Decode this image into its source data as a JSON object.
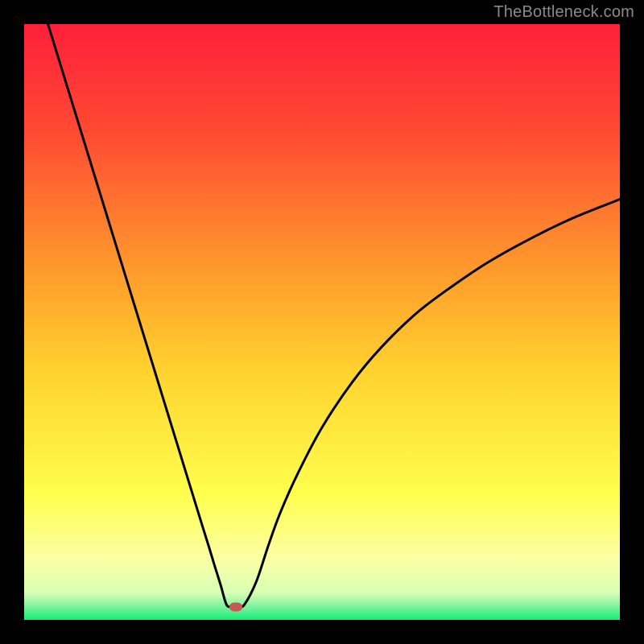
{
  "watermark": "TheBottleneck.com",
  "colors": {
    "top": "#ff1f3a",
    "mid_upper": "#ff8a2b",
    "mid": "#ffd22e",
    "pale": "#ffffb0",
    "green": "#10ef75",
    "frame": "#000000",
    "curve": "#000000",
    "marker": "#c25a52"
  },
  "chart_data": {
    "type": "line",
    "title": "",
    "xlabel": "",
    "ylabel": "",
    "xlim": [
      0,
      100
    ],
    "ylim": [
      0,
      100
    ],
    "series": [
      {
        "name": "bottleneck-curve",
        "x": [
          4,
          6,
          8,
          10,
          12,
          14,
          16,
          18,
          20,
          22,
          24,
          26,
          28,
          30,
          31,
          32,
          33,
          34,
          35,
          36,
          37,
          39,
          41,
          43,
          46,
          50,
          55,
          60,
          66,
          72,
          78,
          85,
          92,
          100
        ],
        "y": [
          100,
          93.5,
          87,
          80.5,
          74,
          67.5,
          61,
          54.5,
          48,
          41.5,
          35,
          28.5,
          22,
          15.5,
          12.3,
          9,
          5.8,
          2.5,
          2.3,
          2.2,
          2.6,
          6.5,
          12.5,
          18.0,
          24.7,
          32.3,
          39.8,
          45.8,
          51.6,
          56.1,
          60.1,
          64.0,
          67.4,
          70.6
        ]
      }
    ],
    "marker": {
      "x": 35.5,
      "y": 2.2
    },
    "gradient_stops": [
      {
        "offset": 0.0,
        "color": "#ff1f3a"
      },
      {
        "offset": 0.18,
        "color": "#ff4a33"
      },
      {
        "offset": 0.4,
        "color": "#ff962c"
      },
      {
        "offset": 0.58,
        "color": "#ffd22e"
      },
      {
        "offset": 0.79,
        "color": "#ffff4d"
      },
      {
        "offset": 0.9,
        "color": "#fbffa6"
      },
      {
        "offset": 0.955,
        "color": "#d6ffb4"
      },
      {
        "offset": 0.975,
        "color": "#8af3a2"
      },
      {
        "offset": 1.0,
        "color": "#10ef75"
      }
    ]
  }
}
